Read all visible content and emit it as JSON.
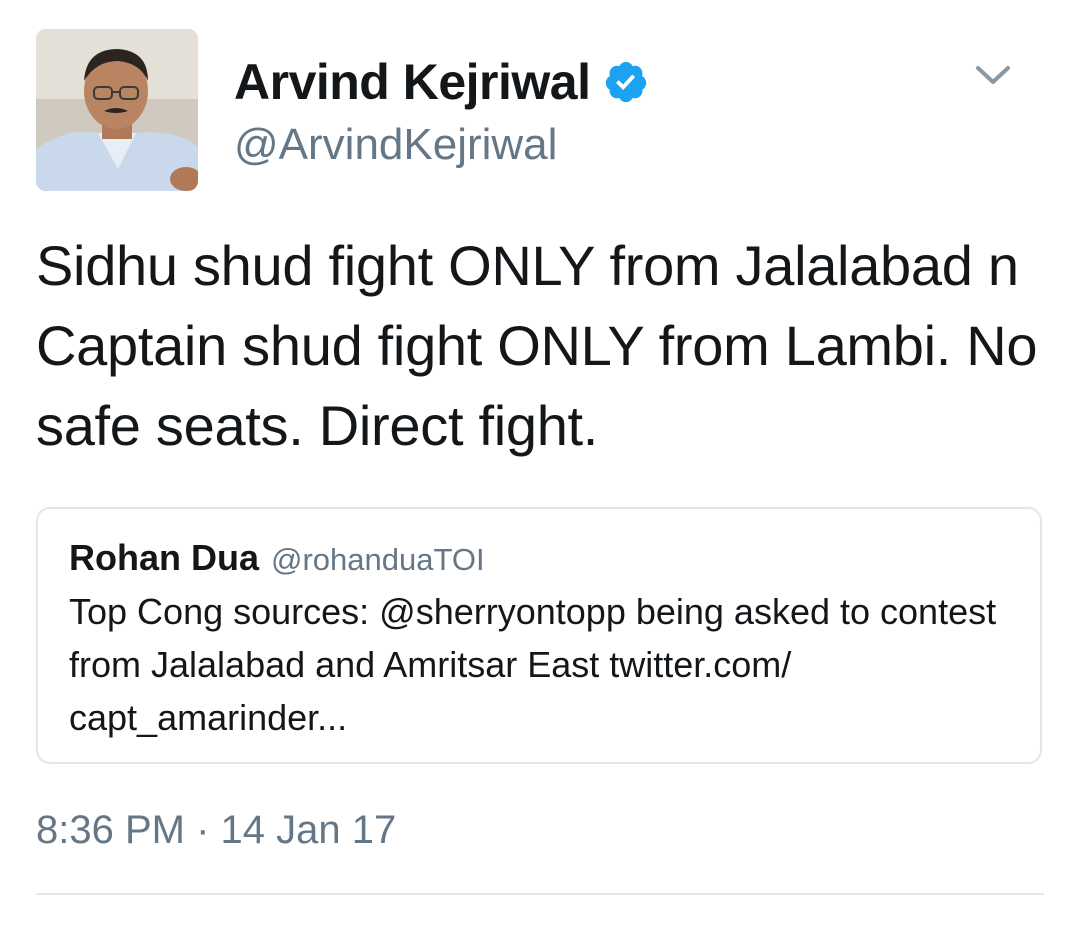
{
  "author": {
    "display_name": "Arvind Kejriwal",
    "handle": "@ArvindKejriwal",
    "verified": true
  },
  "tweet": {
    "text": "Sidhu shud fight ONLY from Jalalabad n Captain shud fight ONLY from Lambi. No safe seats. Direct fight.",
    "timestamp": "8:36 PM · 14 Jan 17"
  },
  "quoted_tweet": {
    "display_name": "Rohan Dua",
    "handle": "@rohanduaTOI",
    "text": "Top Cong sources: @sherryontopp being asked to contest from Jalalabad and Amritsar East twitter.com/ capt_amarinder..."
  },
  "icons": {
    "verified": "verified-badge-icon",
    "menu": "chevron-down-icon"
  },
  "colors": {
    "primary_text": "#14171a",
    "secondary_text": "#657786",
    "verified_blue": "#1da1f2",
    "border": "#e1e8ed"
  }
}
